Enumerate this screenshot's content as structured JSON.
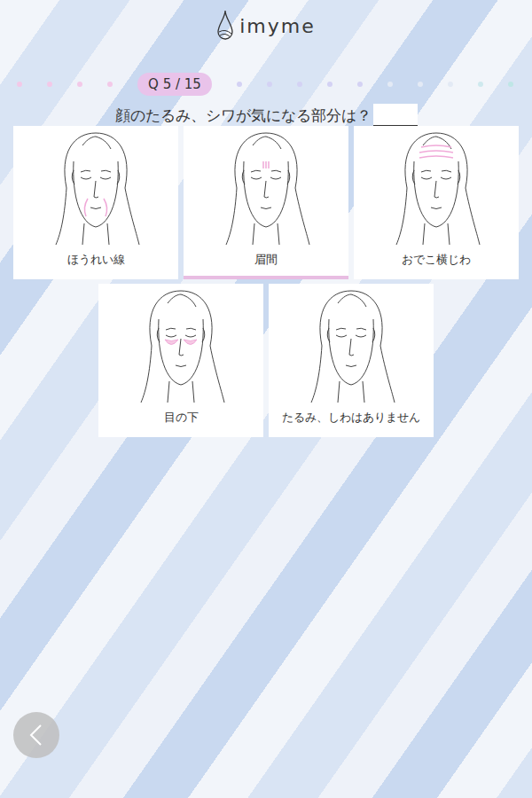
{
  "header": {
    "logo": "imyme"
  },
  "progress": {
    "label": "Q 5 / 15",
    "steps": [
      {
        "current": false,
        "color": "#f3c9e8"
      },
      {
        "current": false,
        "color": "#f3c9e8"
      },
      {
        "current": false,
        "color": "#f3c9e8"
      },
      {
        "current": false,
        "color": "#f3c9e8"
      },
      {
        "current": true,
        "color": "#e9c3ea"
      },
      {
        "current": false,
        "color": "#d4d2f4"
      },
      {
        "current": false,
        "color": "#d4d2f4"
      },
      {
        "current": false,
        "color": "#d4d2f4"
      },
      {
        "current": false,
        "color": "#d4d2f4"
      },
      {
        "current": false,
        "color": "#d4d2f4"
      },
      {
        "current": false,
        "color": "#e3eaf5"
      },
      {
        "current": false,
        "color": "#e3eaf5"
      },
      {
        "current": false,
        "color": "#e3eaf5"
      },
      {
        "current": false,
        "color": "#cfe9ee"
      },
      {
        "current": false,
        "color": "#bfe6e6"
      }
    ]
  },
  "question": {
    "text": "顔のたるみ、シワが気になる部分は？"
  },
  "options": [
    {
      "label": "ほうれい線",
      "kind": "nasolabial",
      "selected": false
    },
    {
      "label": "眉間",
      "kind": "glabella",
      "selected": true
    },
    {
      "label": "おでこ横じわ",
      "kind": "forehead",
      "selected": false
    },
    {
      "label": "目の下",
      "kind": "undereye",
      "selected": false
    },
    {
      "label": "たるみ、しわはありません",
      "kind": "none",
      "selected": false
    }
  ]
}
